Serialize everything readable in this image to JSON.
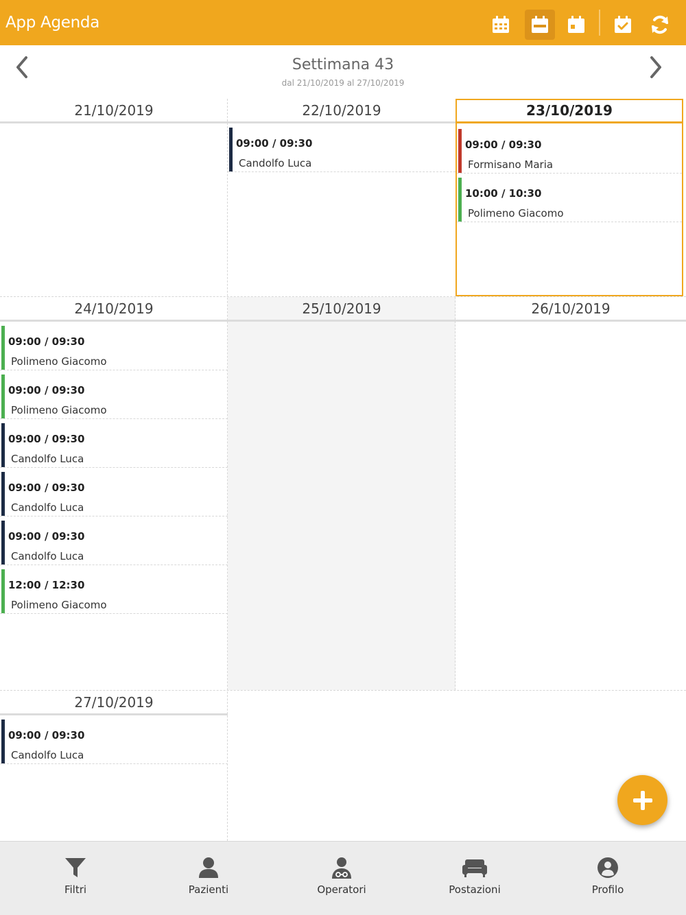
{
  "app": {
    "title": "App Agenda"
  },
  "header_icons": [
    {
      "name": "calendar-month-icon",
      "active": false
    },
    {
      "name": "calendar-week-icon",
      "active": true
    },
    {
      "name": "calendar-day-icon",
      "active": false
    },
    {
      "name": "calendar-check-icon",
      "active": false
    },
    {
      "name": "refresh-icon",
      "active": false
    }
  ],
  "week": {
    "title": "Settimana 43",
    "range": "dal 21/10/2019 al 27/10/2019"
  },
  "days": [
    {
      "date": "21/10/2019",
      "appointments": []
    },
    {
      "date": "22/10/2019",
      "appointments": [
        {
          "time": "09:00 / 09:30",
          "patient": "Candolfo Luca",
          "color": "#1c2b44"
        }
      ]
    },
    {
      "date": "23/10/2019",
      "today": true,
      "appointments": [
        {
          "time": "09:00 / 09:30",
          "patient": "Formisano Maria",
          "color": "#c0392b"
        },
        {
          "time": "10:00 / 10:30",
          "patient": "Polimeno Giacomo",
          "color": "#4caf50"
        }
      ]
    },
    {
      "date": "24/10/2019",
      "appointments": [
        {
          "time": "09:00 / 09:30",
          "patient": "Polimeno Giacomo",
          "color": "#4caf50"
        },
        {
          "time": "09:00 / 09:30",
          "patient": "Polimeno Giacomo",
          "color": "#4caf50"
        },
        {
          "time": "09:00 / 09:30",
          "patient": "Candolfo Luca",
          "color": "#1c2b44"
        },
        {
          "time": "09:00 / 09:30",
          "patient": "Candolfo Luca",
          "color": "#1c2b44"
        },
        {
          "time": "09:00 / 09:30",
          "patient": "Candolfo Luca",
          "color": "#1c2b44"
        },
        {
          "time": "12:00 / 12:30",
          "patient": "Polimeno Giacomo",
          "color": "#4caf50"
        }
      ]
    },
    {
      "date": "25/10/2019",
      "closed": true,
      "appointments": []
    },
    {
      "date": "26/10/2019",
      "appointments": []
    },
    {
      "date": "27/10/2019",
      "appointments": [
        {
          "time": "09:00 / 09:30",
          "patient": "Candolfo Luca",
          "color": "#1c2b44"
        }
      ]
    }
  ],
  "bottom_nav": [
    {
      "label": "Filtri",
      "icon": "filter-icon"
    },
    {
      "label": "Pazienti",
      "icon": "user-icon"
    },
    {
      "label": "Operatori",
      "icon": "doctor-icon"
    },
    {
      "label": "Postazioni",
      "icon": "couch-icon"
    },
    {
      "label": "Profilo",
      "icon": "profile-icon"
    }
  ],
  "colors": {
    "accent": "#f0a71e",
    "dark": "#1c2b44",
    "green": "#4caf50",
    "red": "#c0392b"
  }
}
